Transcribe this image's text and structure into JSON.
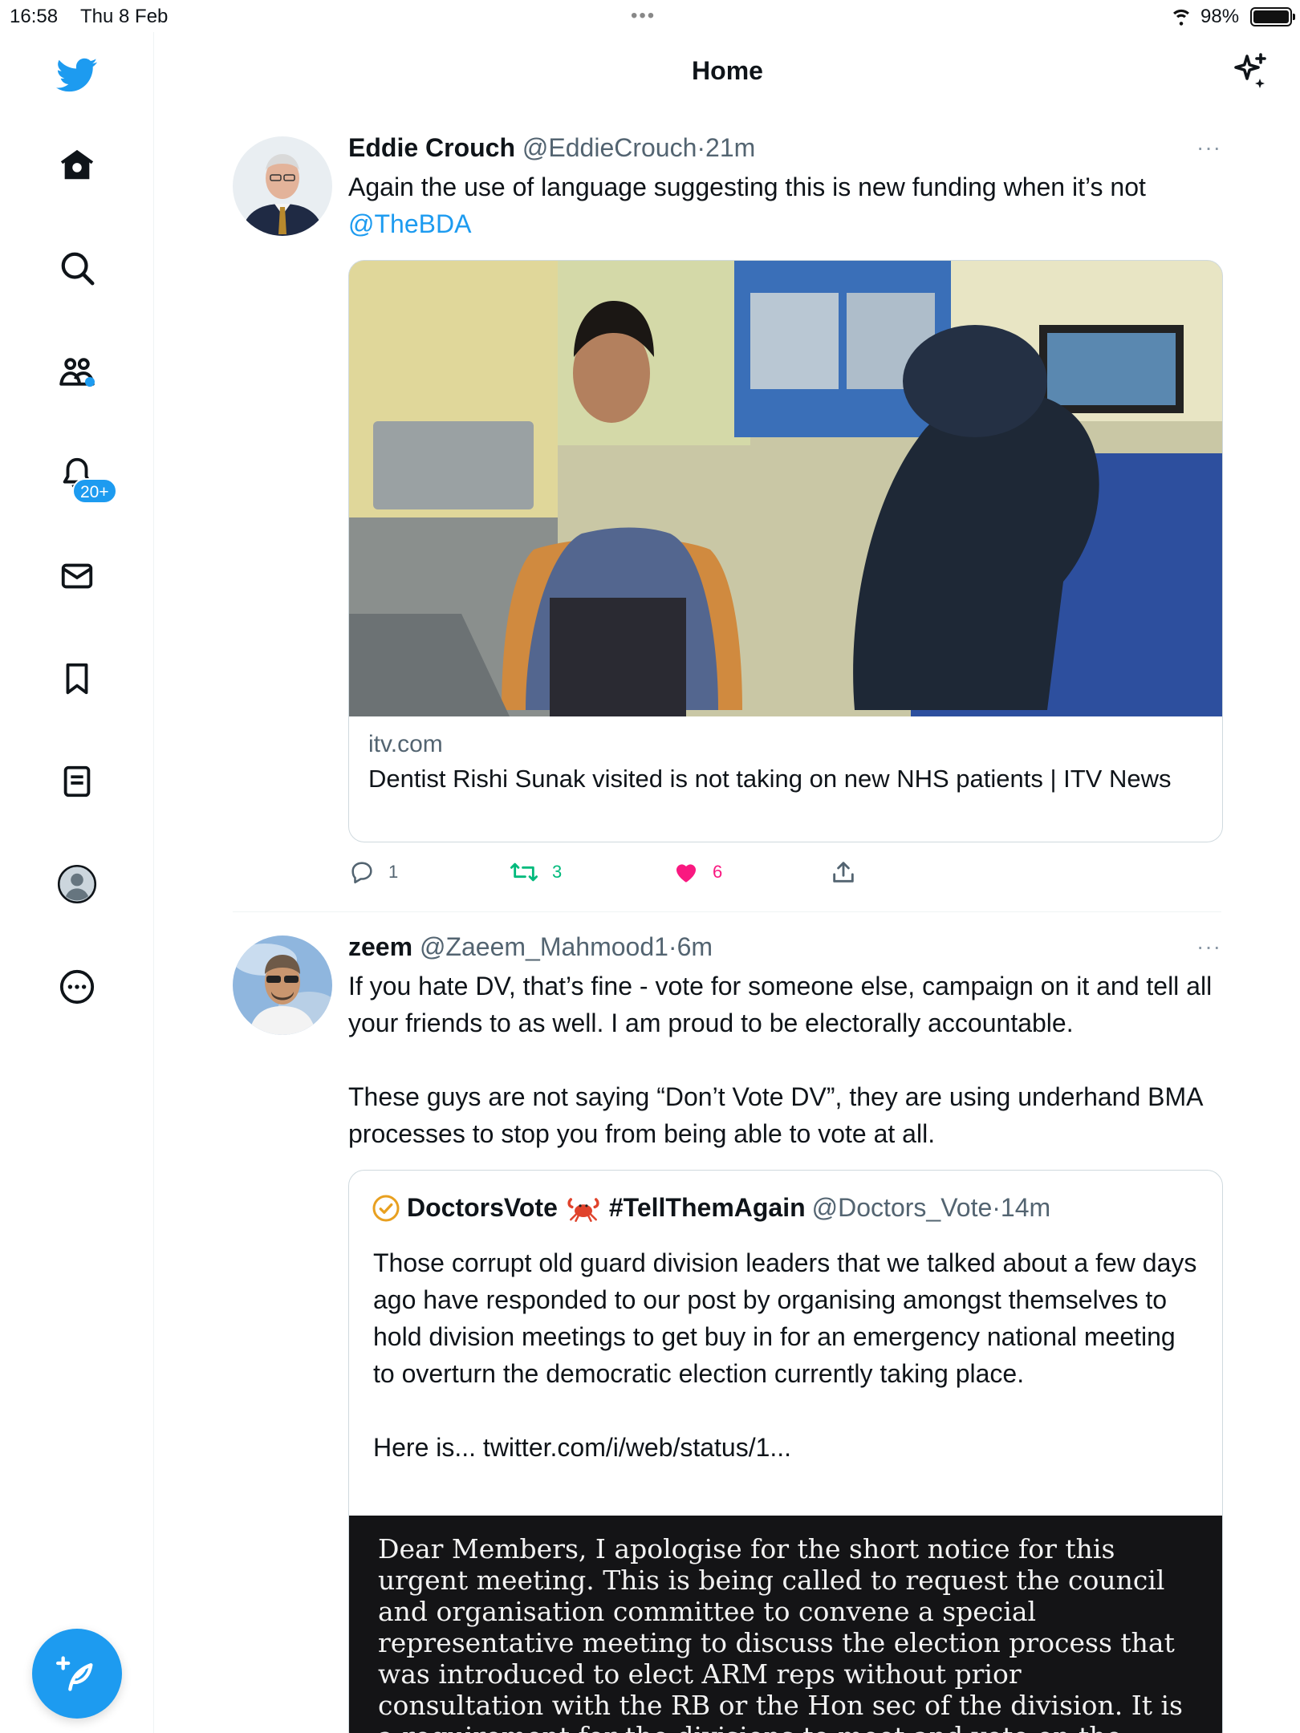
{
  "status_bar": {
    "time": "16:58",
    "date": "Thu 8 Feb",
    "battery": "98%",
    "battery_level": 0.98
  },
  "sidebar": {
    "items": [
      {
        "icon": "twitter-logo-icon"
      },
      {
        "icon": "home-icon"
      },
      {
        "icon": "search-icon"
      },
      {
        "icon": "communities-icon"
      },
      {
        "icon": "notifications-icon",
        "badge": "20+"
      },
      {
        "icon": "messages-icon"
      },
      {
        "icon": "bookmarks-icon"
      },
      {
        "icon": "lists-icon"
      },
      {
        "icon": "profile-icon"
      },
      {
        "icon": "more-icon"
      }
    ],
    "compose_icon": "compose-tweet-icon"
  },
  "header": {
    "title": "Home"
  },
  "colors": {
    "accent": "#1d9bf0",
    "retweet": "#00ba7c",
    "like": "#f91880",
    "secondary_text": "#536471"
  },
  "tweets": [
    {
      "name": "Eddie Crouch",
      "handle": "@EddieCrouch",
      "sep": "·",
      "time": "21m",
      "more": "···",
      "text": "Again the use of language suggesting this is new funding when it’s not",
      "mention": "@TheBDA",
      "card": {
        "domain": "itv.com",
        "title": "Dentist Rishi Sunak visited is not taking on new NHS patients | ITV News"
      },
      "actions": {
        "replies": "1",
        "retweets": "3",
        "likes": "6",
        "liked": true
      }
    },
    {
      "name": "zeem",
      "handle": "@Zaeem_Mahmood1",
      "sep": "·",
      "time": "6m",
      "more": "···",
      "text_p1": "If you hate DV, that’s fine -  vote for someone else, campaign on it and tell all your friends to as well. I am proud to be electorally accountable.",
      "text_p2": "These guys are not saying “Don’t Vote DV”, they are using underhand BMA processes to stop you from being able to vote at all.",
      "quote": {
        "name": "DoctorsVote",
        "hashtag": "#TellThemAgain",
        "handle": "@Doctors_Vote",
        "sep": "·",
        "time": "14m",
        "text_p1": "Those corrupt old guard division leaders that we talked about a few days ago have responded to our post by organising amongst themselves to hold division meetings to get buy in for an emergency national meeting to overturn the democratic election currently taking place.",
        "text_p2": "Here is... twitter.com/i/web/status/1...",
        "image_text": "Dear Members, I apologise for the short notice for this urgent meeting. This is being called to request the council and organisation committee to convene a special representative meeting to discuss the election process that was introduced to elect ARM reps without prior consultation with the RB or the Hon sec of the division. It is a requirement for the divisions to meet and vote on the proposal for council to consider."
      }
    }
  ]
}
